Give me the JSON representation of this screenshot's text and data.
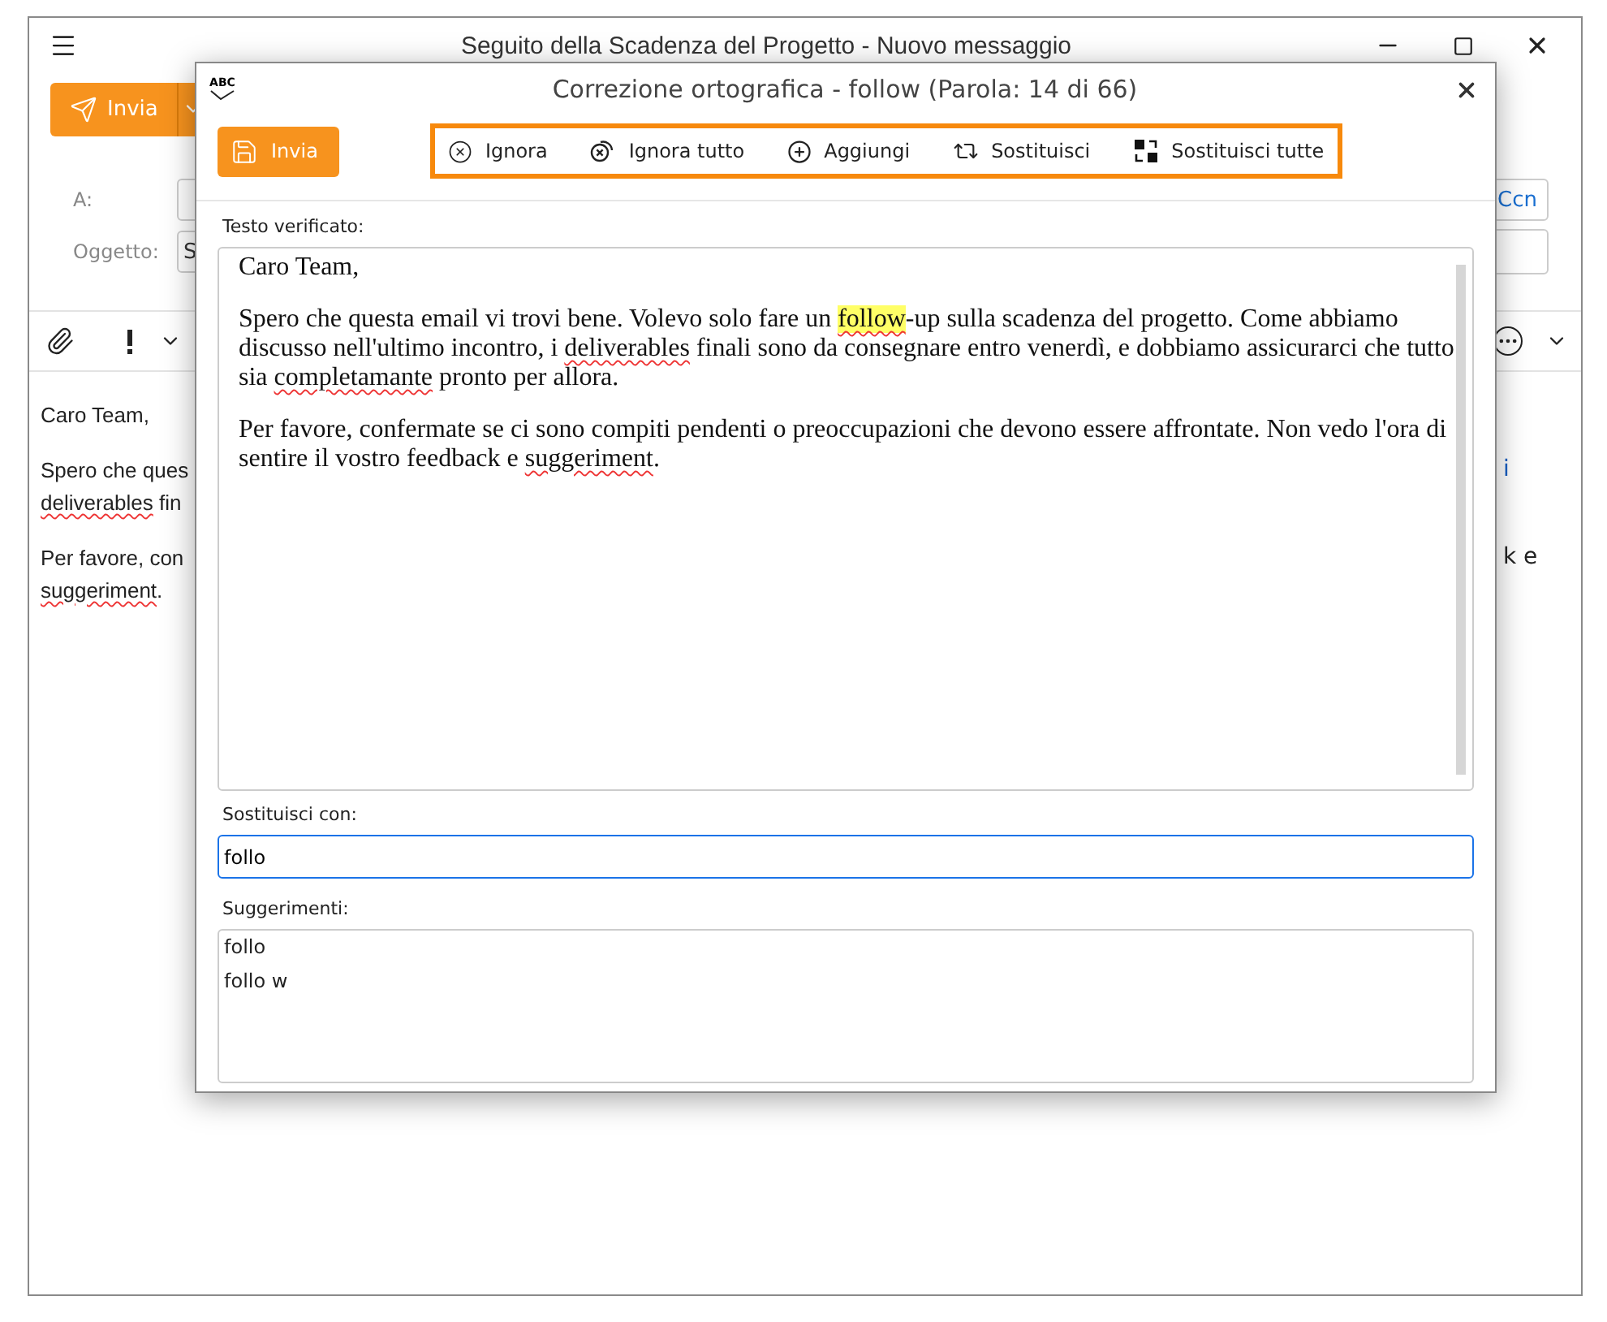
{
  "window": {
    "title": "Seguito della Scadenza del Progetto - Nuovo messaggio"
  },
  "toolbar": {
    "send_label": "Invia"
  },
  "header": {
    "to_label": "A:",
    "subject_label": "Oggetto:",
    "subject_value": "S",
    "ccn_label": "Ccn"
  },
  "body": {
    "paragraphs": [
      {
        "lines": [
          {
            "left": [
              {
                "text": "Caro Team,",
                "kind": "plain"
              }
            ]
          }
        ]
      },
      {
        "lines": [
          {
            "left": [
              {
                "text": "Spero che ques",
                "kind": "plain"
              }
            ],
            "right": [
              {
                "text": "i",
                "kind": "link"
              }
            ]
          },
          {
            "left": [
              {
                "text": "deliverables",
                "kind": "misspelled"
              },
              {
                "text": " fin",
                "kind": "plain"
              }
            ]
          }
        ]
      },
      {
        "lines": [
          {
            "left": [
              {
                "text": "Per favore, con",
                "kind": "plain"
              }
            ],
            "right": [
              {
                "text": "k e",
                "kind": "plain"
              }
            ]
          },
          {
            "left": [
              {
                "text": "suggeriment",
                "kind": "misspelled"
              },
              {
                "text": ".",
                "kind": "plain"
              }
            ]
          }
        ]
      }
    ]
  },
  "dialog": {
    "icon_label": "ABC",
    "title": "Correzione ortografica - follow (Parola: 14 di 66)",
    "send_label": "Invia",
    "actions": [
      {
        "label": "Ignora",
        "kind": "ignore"
      },
      {
        "label": "Ignora tutto",
        "kind": "ignore_all"
      },
      {
        "label": "Aggiungi",
        "kind": "add"
      },
      {
        "label": "Sostituisci",
        "kind": "replace"
      },
      {
        "label": "Sostituisci tutte",
        "kind": "replace_all"
      }
    ],
    "checked_label": "Testo verificato:",
    "checked_paragraphs": [
      [
        {
          "text": "Caro Team,",
          "kind": "plain"
        }
      ],
      [
        {
          "text": "Spero che questa email vi trovi bene. Volevo solo fare un ",
          "kind": "plain"
        },
        {
          "text": "follow",
          "kind": "current"
        },
        {
          "text": "-up sulla scadenza del progetto. Come abbiamo discusso nell'ultimo incontro, i ",
          "kind": "plain"
        },
        {
          "text": "deliverables",
          "kind": "misspelled"
        },
        {
          "text": " finali sono da consegnare entro venerdì, e dobbiamo assicurarci che tutto sia ",
          "kind": "plain"
        },
        {
          "text": "completamante",
          "kind": "misspelled"
        },
        {
          "text": " pronto per allora.",
          "kind": "plain"
        }
      ],
      [
        {
          "text": "Per favore, confermate se ci sono compiti pendenti o preoccupazioni che devono essere affrontate. Non vedo l'ora di sentire il vostro feedback e ",
          "kind": "plain"
        },
        {
          "text": "suggeriment",
          "kind": "misspelled"
        },
        {
          "text": ".",
          "kind": "plain"
        }
      ]
    ],
    "replace_label": "Sostituisci con:",
    "replace_value": "follo",
    "suggestions_label": "Suggerimenti:",
    "suggestions": [
      {
        "text": "follo",
        "selected": false
      },
      {
        "text": "follo w",
        "selected": false
      }
    ]
  }
}
